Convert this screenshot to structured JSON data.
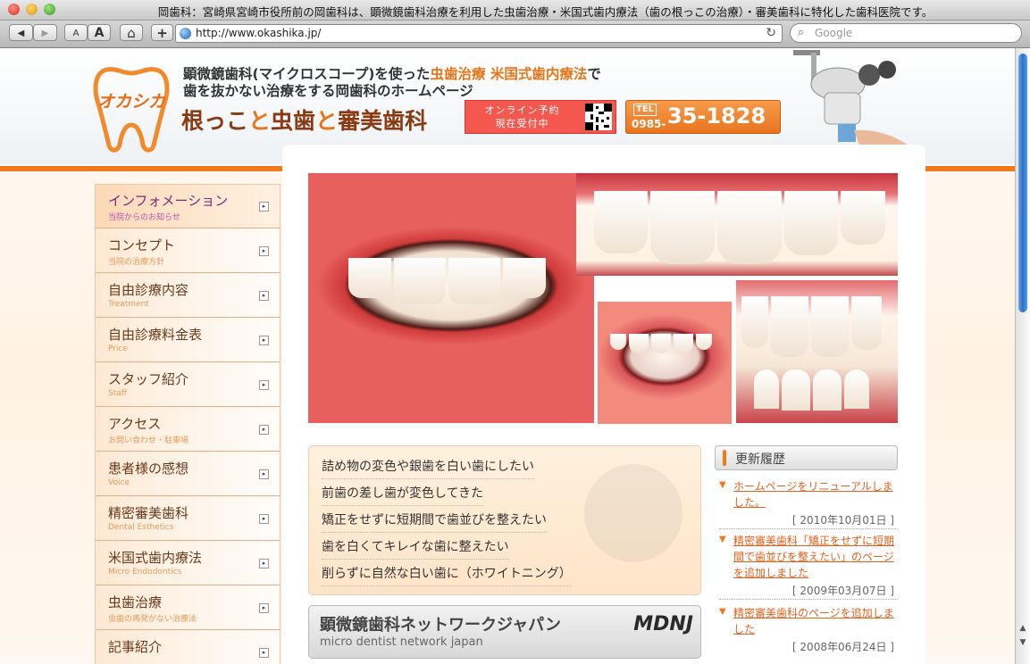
{
  "window": {
    "title": "岡歯科：宮崎県宮崎市役所前の岡歯科は、顕微鏡歯科治療を利用した虫歯治療・米国式歯内療法（歯の根っこの治療）・審美歯科に特化した歯科医院です。"
  },
  "toolbar": {
    "back": "◀",
    "forward": "▶",
    "text_smaller": "A",
    "text_larger": "A",
    "home": "⌂",
    "add_bookmark": "+",
    "url": "http://www.okashika.jp/",
    "search_placeholder": "Google"
  },
  "header": {
    "logo_text": "オカシカ",
    "tagline1_pre": "顕微鏡歯科(マイクロスコープ)を使った",
    "tagline1_hl": "虫歯治療 米国式歯内療法",
    "tagline1_post": "で",
    "tagline2": "歯を抜かない治療をする岡歯科のホームページ",
    "brand_part1": "根っこ",
    "brand_to1": "と",
    "brand_part2": "虫歯",
    "brand_to2": "と",
    "brand_part3": "審美歯科",
    "reserve_line1": "オンライン予約",
    "reserve_line2": "現在受付中",
    "tel_label": "TEL",
    "tel_prefix": "0985-",
    "tel_number": "35-1828"
  },
  "sidebar": {
    "items": [
      {
        "jp": "インフォメーション",
        "en": "当院からのお知らせ"
      },
      {
        "jp": "コンセプト",
        "en": "当院の治療方針"
      },
      {
        "jp": "自由診療内容",
        "en": "Treatment"
      },
      {
        "jp": "自由診療料金表",
        "en": "Price"
      },
      {
        "jp": "スタッフ紹介",
        "en": "Staff"
      },
      {
        "jp": "アクセス",
        "en": "お問い合わせ・駐車場"
      },
      {
        "jp": "患者様の感想",
        "en": "Voice"
      },
      {
        "jp": "精密審美歯科",
        "en": "Dental Esthetics"
      },
      {
        "jp": "米国式歯内療法",
        "en": "Micro Endodontics"
      },
      {
        "jp": "虫歯治療",
        "en": "虫歯の再発がない治療法"
      },
      {
        "jp": "記事紹介",
        "en": ""
      }
    ]
  },
  "features": [
    "詰め物の変色や銀歯を白い歯にしたい",
    "前歯の差し歯が変色してきた",
    "矯正をせずに短期間で歯並びを整えたい",
    "歯を白くてキレイな歯に整えたい",
    "削らずに自然な白い歯に（ホワイトニング）"
  ],
  "banner": {
    "jp": "顕微鏡歯科ネットワークジャパン",
    "en": "micro dentist network japan",
    "logo": "MDNJ"
  },
  "news": {
    "title": "更新履歴",
    "items": [
      {
        "text": "ホームページをリニューアルしました。",
        "date": "[ 2010年10月01日 ]"
      },
      {
        "text": "精密審美歯科「矯正をせずに短期間で歯並びを整えたい」のページを追加しました",
        "date": "[ 2009年03月07日 ]"
      },
      {
        "text": "精密審美歯科のページを追加しました",
        "date": "[ 2008年06月24日 ]"
      }
    ]
  },
  "colors": {
    "accent_orange": "#f07a1a",
    "reserve_red": "#f4574e",
    "brand_brown": "#8a3a12"
  }
}
